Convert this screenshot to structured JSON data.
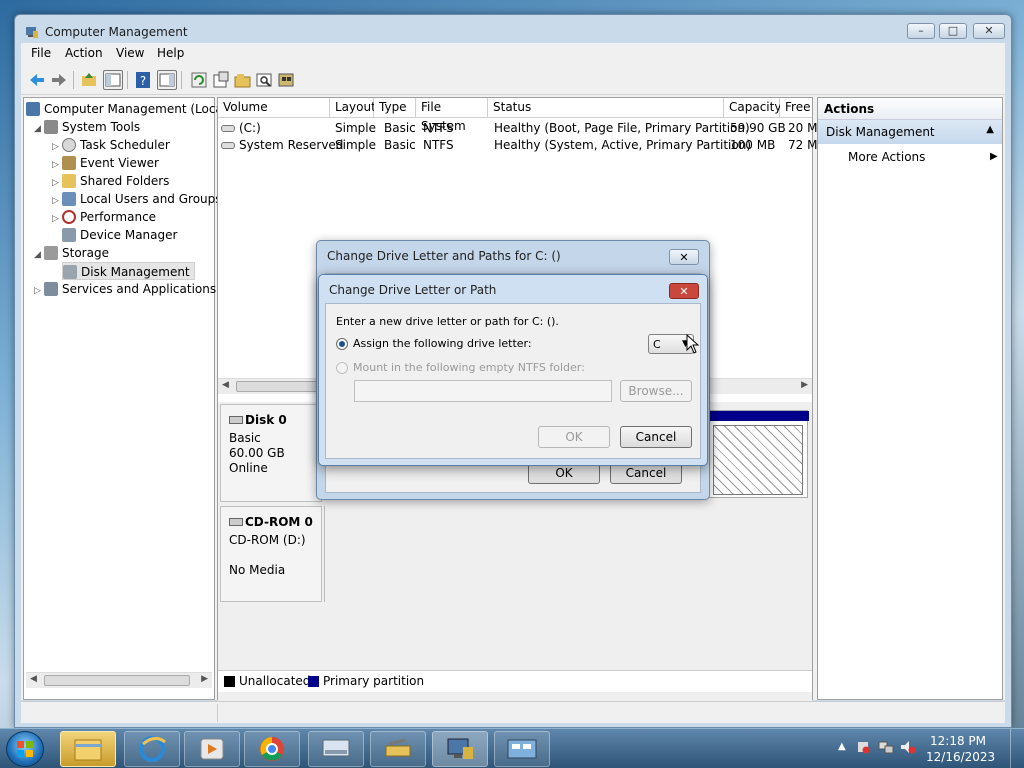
{
  "window": {
    "title": "Computer Management",
    "controls": {
      "minimize": "–",
      "maximize": "□",
      "close": "✕"
    }
  },
  "menu": [
    "File",
    "Action",
    "View",
    "Help"
  ],
  "tree": {
    "root": "Computer Management (Local",
    "system_tools": "System Tools",
    "task_scheduler": "Task Scheduler",
    "event_viewer": "Event Viewer",
    "shared_folders": "Shared Folders",
    "local_users": "Local Users and Groups",
    "performance": "Performance",
    "device_manager": "Device Manager",
    "storage": "Storage",
    "disk_management": "Disk Management",
    "services": "Services and Applications"
  },
  "volumes": {
    "headers": [
      "Volume",
      "Layout",
      "Type",
      "File System",
      "Status",
      "Capacity",
      "Free"
    ],
    "rows": [
      [
        "(C:)",
        "Simple",
        "Basic",
        "NTFS",
        "Healthy (Boot, Page File, Primary Partition)",
        "59.90 GB",
        "20 M"
      ],
      [
        "System Reserved",
        "Simple",
        "Basic",
        "NTFS",
        "Healthy (System, Active, Primary Partition)",
        "100 MB",
        "72 M"
      ]
    ]
  },
  "disks": {
    "disk0": {
      "name": "Disk 0",
      "type": "Basic",
      "size": "60.00 GB",
      "state": "Online"
    },
    "cdrom0": {
      "name": "CD-ROM 0",
      "type": "CD-ROM (D:)",
      "media": "No Media"
    }
  },
  "legend": {
    "unallocated": "Unallocated",
    "primary": "Primary partition"
  },
  "actions": {
    "header": "Actions",
    "section": "Disk Management",
    "more": "More Actions"
  },
  "dialog_outer": {
    "title": "Change Drive Letter and Paths for C: ()",
    "ok": "OK",
    "cancel": "Cancel"
  },
  "dialog_inner": {
    "title": "Change Drive Letter or Path",
    "prompt": "Enter a new drive letter or path for C: ().",
    "assign_label": "Assign the following drive letter:",
    "drive_letter": "C",
    "mount_label": "Mount in the following empty NTFS folder:",
    "browse": "Browse...",
    "ok": "OK",
    "cancel": "Cancel"
  },
  "clock": {
    "time": "12:18 PM",
    "date": "12/16/2023"
  },
  "colors": {
    "primary_partition": "#00008b",
    "unallocated": "#000000",
    "dialog_close": "#c9473d"
  }
}
